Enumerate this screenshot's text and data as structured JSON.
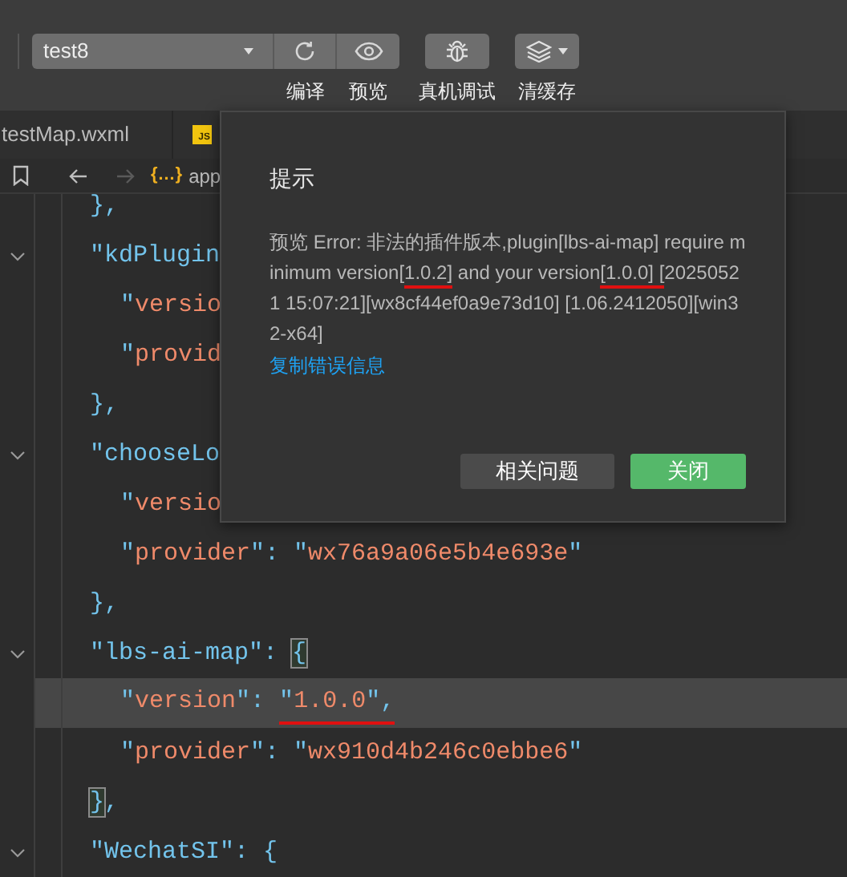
{
  "toolbar": {
    "project": "test8",
    "buttons": [
      {
        "kind": "compile",
        "label": "编译"
      },
      {
        "kind": "preview",
        "label": "预览"
      },
      {
        "kind": "debug",
        "label": "真机调试"
      },
      {
        "kind": "cache",
        "label": "清缓存"
      }
    ]
  },
  "tabs": [
    {
      "label": "testMap.wxml",
      "kind": "wxml"
    },
    {
      "label": "JS",
      "kind": "js"
    }
  ],
  "breadcrumb": {
    "back_disabled": false,
    "forward_disabled": true,
    "file_icon": "{…}",
    "path": "app"
  },
  "code": {
    "lines": [
      {
        "tokens": [
          {
            "kind": "key",
            "text": "},"
          }
        ]
      },
      {
        "tokens": [
          {
            "kind": "key",
            "text": "\"kdPlugin"
          }
        ],
        "expanded": true,
        "children": [
          {
            "tokens": [
              {
                "kind": "key",
                "text": "\""
              },
              {
                "kind": "string",
                "text": "versio"
              }
            ]
          },
          {
            "tokens": [
              {
                "kind": "key",
                "text": "\""
              },
              {
                "kind": "string",
                "text": "provid"
              }
            ]
          }
        ]
      },
      {
        "tokens": [
          {
            "kind": "key",
            "text": "},"
          }
        ]
      },
      {
        "tokens": [
          {
            "kind": "key",
            "text": "\"chooseLo"
          }
        ],
        "expanded": true,
        "children": [
          {
            "tokens": [
              {
                "kind": "key",
                "text": "\""
              },
              {
                "kind": "string",
                "text": "versio"
              }
            ]
          },
          {
            "tokens": [
              {
                "kind": "key",
                "text": "\""
              },
              {
                "kind": "string",
                "text": "provider"
              },
              {
                "kind": "key",
                "text": "\": \""
              },
              {
                "kind": "string",
                "text": "wx76a9a06e5b4e693e"
              },
              {
                "kind": "key",
                "text": "\""
              }
            ]
          }
        ]
      },
      {
        "tokens": [
          {
            "kind": "key",
            "text": "},"
          }
        ]
      },
      {
        "tokens": [
          {
            "kind": "key",
            "text": "\"lbs-ai-map\": "
          },
          {
            "kind": "key",
            "text": "{",
            "matched": true
          }
        ],
        "expanded": true,
        "children": [
          {
            "current": true,
            "tokens": [
              {
                "kind": "key",
                "text": "\""
              },
              {
                "kind": "string",
                "text": "version"
              },
              {
                "kind": "key",
                "text": "\": "
              },
              {
                "kind": "key",
                "text": "\"",
                "underlined": true
              },
              {
                "kind": "string",
                "text": "1.0.0",
                "underlined": true
              },
              {
                "kind": "key",
                "text": "\"",
                "underlined": true
              },
              {
                "kind": "key",
                "text": ",",
                "underlined": true
              }
            ]
          },
          {
            "tokens": [
              {
                "kind": "key",
                "text": "\""
              },
              {
                "kind": "string",
                "text": "provider"
              },
              {
                "kind": "key",
                "text": "\": \""
              },
              {
                "kind": "string",
                "text": "wx910d4b246c0ebbe6"
              },
              {
                "kind": "key",
                "text": "\""
              }
            ]
          }
        ]
      },
      {
        "tokens": [
          {
            "kind": "key",
            "text": "}",
            "matched": true
          },
          {
            "kind": "key",
            "text": ","
          }
        ]
      },
      {
        "tokens": [
          {
            "kind": "key",
            "text": "\"WechatSI\": {"
          }
        ],
        "expanded": true
      }
    ]
  },
  "dialog": {
    "title": "提示",
    "message": [
      {
        "text": "预览 Error: 非法的插件版本,plugin[lbs-ai-map] require minimum version[",
        "underlined": false
      },
      {
        "text": "1.0.2]",
        "underlined": true
      },
      {
        "text": " and your version",
        "underlined": false
      },
      {
        "text": "[1.0.0] [",
        "underlined": true
      },
      {
        "text": "20250521 15:07:21][wx8cf44ef0a9e73d10] [1.06.2412050][win32-x64]",
        "underlined": false
      }
    ],
    "link": "复制错误信息",
    "buttons": [
      {
        "label": "相关问题",
        "kind": "secondary"
      },
      {
        "label": "关闭",
        "kind": "primary"
      }
    ]
  }
}
